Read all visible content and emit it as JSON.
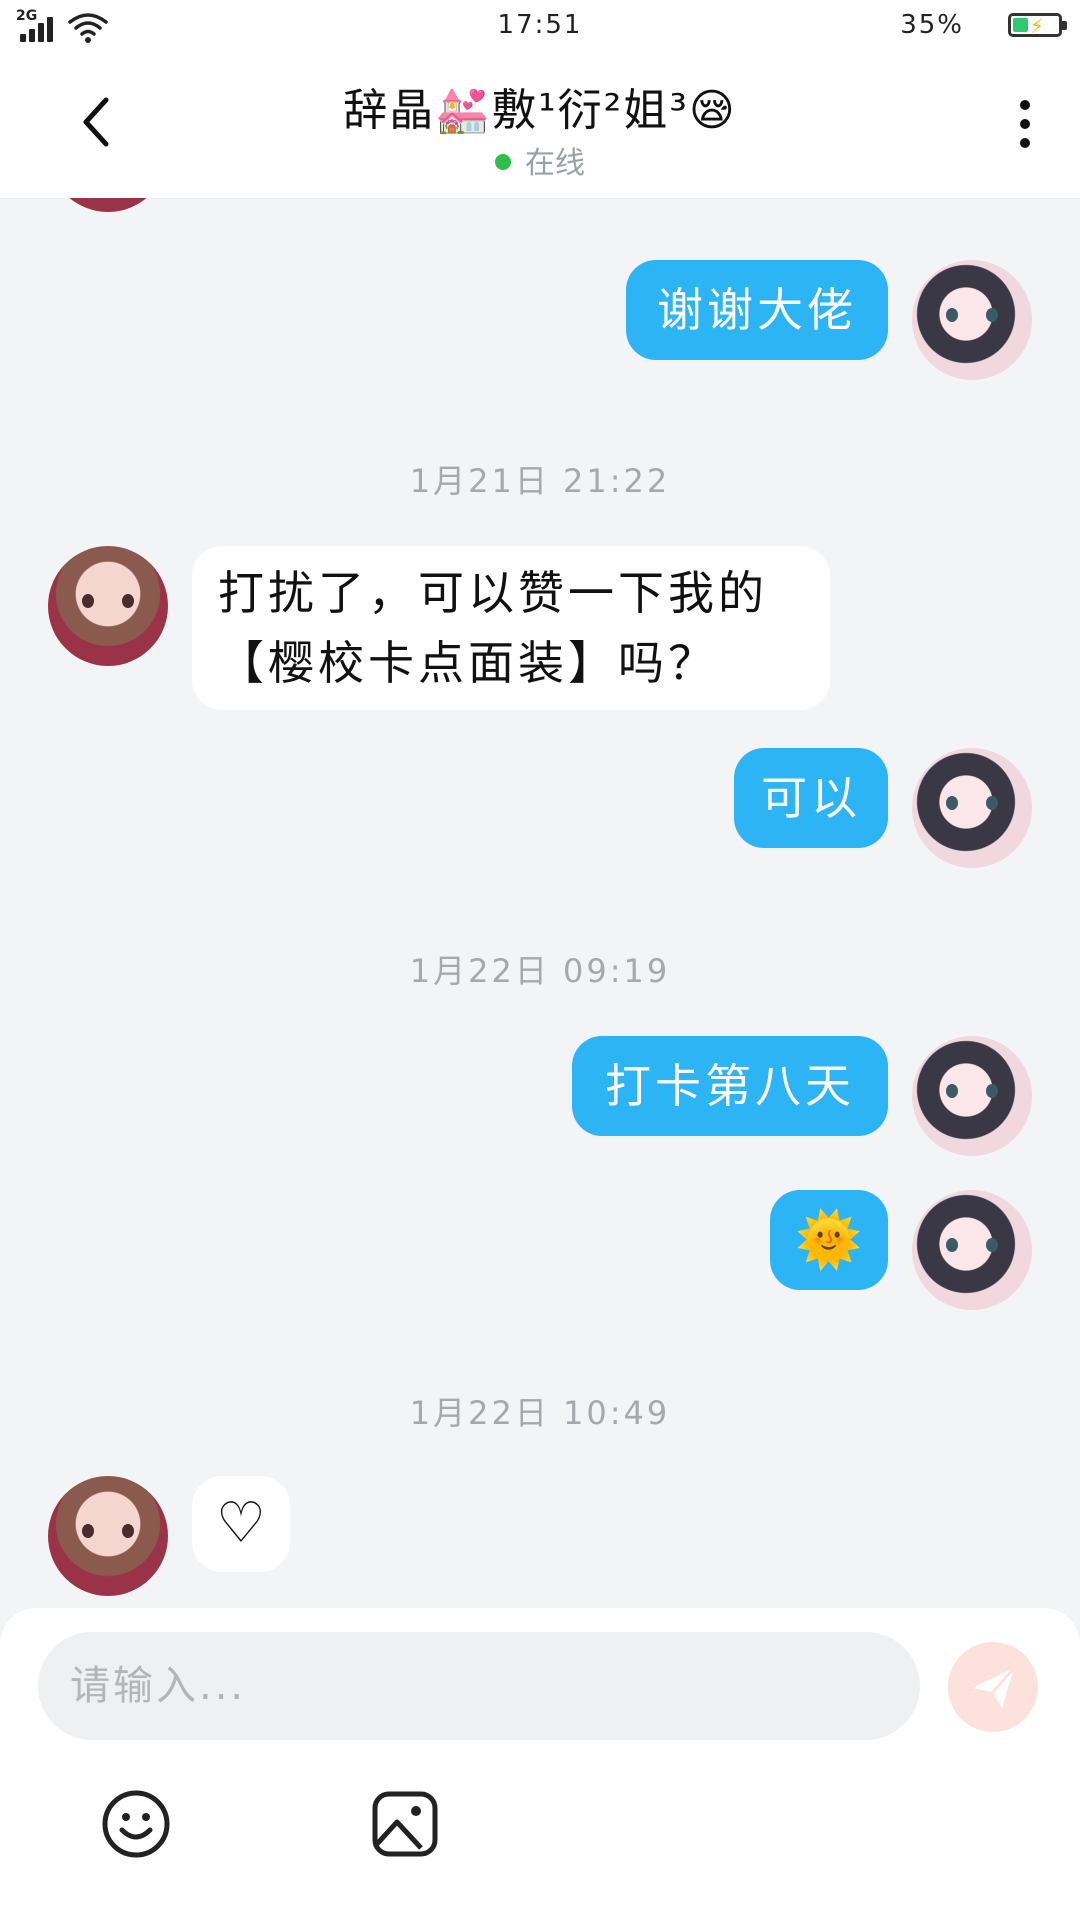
{
  "status_bar": {
    "network": "2G",
    "time": "17:51",
    "battery_percent": "35%",
    "battery_level": 0.35,
    "battery_color": "#2ecc71"
  },
  "header": {
    "contact_name": "辞晶💒敷¹衍²姐³😪",
    "presence": "在线",
    "presence_color": "#2fbf4a",
    "back_icon": "chevron-left-icon",
    "more_icon": "more-vertical-icon"
  },
  "messages": [
    {
      "id": "m1",
      "direction": "out",
      "text": "谢谢大佬"
    },
    {
      "id": "t1",
      "type": "timestamp",
      "text": "1月21日 21:22"
    },
    {
      "id": "m2",
      "direction": "in",
      "lines": [
        "打扰了，可以赞一下我的",
        "【樱校卡点面装】吗？"
      ]
    },
    {
      "id": "m3",
      "direction": "out",
      "text": "可以"
    },
    {
      "id": "t2",
      "type": "timestamp",
      "text": "1月22日 09:19"
    },
    {
      "id": "m4",
      "direction": "out",
      "text": "打卡第八天"
    },
    {
      "id": "m5",
      "direction": "out",
      "text": "🌞"
    },
    {
      "id": "t3",
      "type": "timestamp",
      "text": "1月22日 10:49"
    },
    {
      "id": "m6",
      "direction": "in",
      "text": "♡"
    }
  ],
  "composer": {
    "placeholder": "请输入...",
    "send_icon": "send-icon",
    "emoji_icon": "emoji-icon",
    "image_icon": "image-icon"
  },
  "colors": {
    "outgoing_bubble": "#2cb4f5",
    "incoming_bubble": "#ffffff",
    "background": "#f3f4f6",
    "send_button": "#fde1dc"
  }
}
